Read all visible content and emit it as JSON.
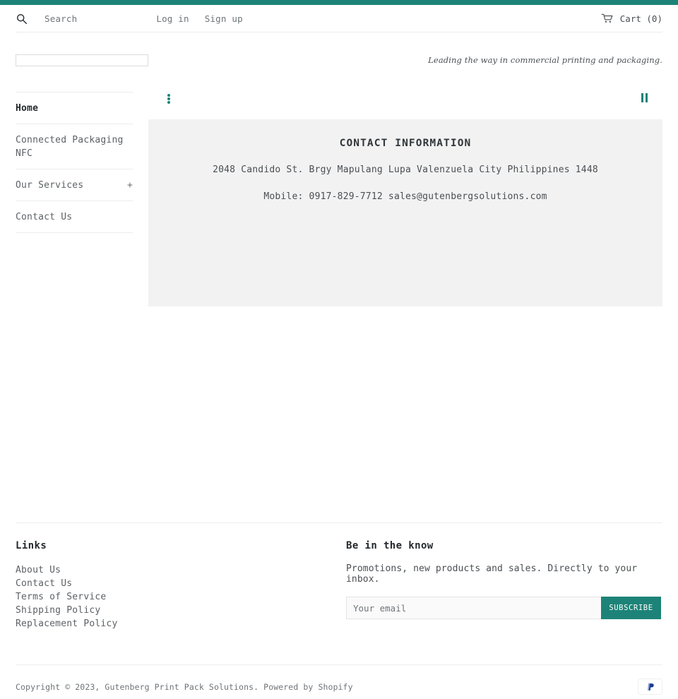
{
  "topbar": {
    "color": "#1d8378"
  },
  "utility": {
    "search_icon": "search-icon",
    "search_label": "Search",
    "login_label": "Log in",
    "signup_label": "Sign up",
    "cart_icon": "shopping-cart-icon",
    "cart_label": "Cart (0)"
  },
  "masthead": {
    "logo_alt": "",
    "tagline": "Leading the way in commercial printing and packaging."
  },
  "sidebar": {
    "items": [
      {
        "label": "Home",
        "active": true,
        "expander": ""
      },
      {
        "label": "Connected Packaging NFC",
        "active": false,
        "expander": ""
      },
      {
        "label": "Our Services",
        "active": false,
        "expander": "+"
      },
      {
        "label": "Contact Us",
        "active": false,
        "expander": ""
      }
    ]
  },
  "slideshow": {
    "prev_icon": "slide-dots-icon",
    "pause_icon": "pause-icon",
    "pause_label": "Pause slideshow"
  },
  "hero": {
    "heading": "CONTACT INFORMATION",
    "address": "2048 Candido St. Brgy Mapulang Lupa Valenzuela City Philippines 1448",
    "contact": "Mobile: 0917-829-7712 sales@gutenbergsolutions.com"
  },
  "footer": {
    "links_title": "Links",
    "links": [
      "About Us",
      "Contact Us",
      "Terms of Service",
      "Shipping Policy",
      "Replacement Policy"
    ],
    "newsletter_title": "Be in the know",
    "newsletter_text": "Promotions, new products and sales. Directly to your inbox.",
    "email_placeholder": "Your email",
    "email_value": "",
    "subscribe_label": "SUBSCRIBE",
    "copyright": "Copyright © 2023, Gutenberg Print Pack Solutions. Powered by Shopify",
    "payment_icons": [
      "paypal-icon"
    ]
  }
}
